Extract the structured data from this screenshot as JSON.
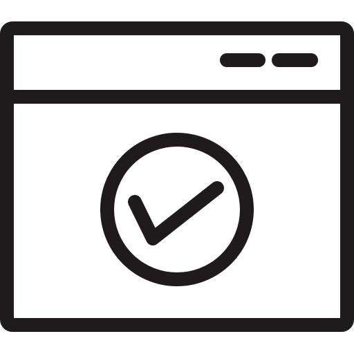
{
  "icon": {
    "name": "browser-window-check-icon",
    "stroke_color": "#1f1a1c",
    "background_color": "#ffffff"
  }
}
